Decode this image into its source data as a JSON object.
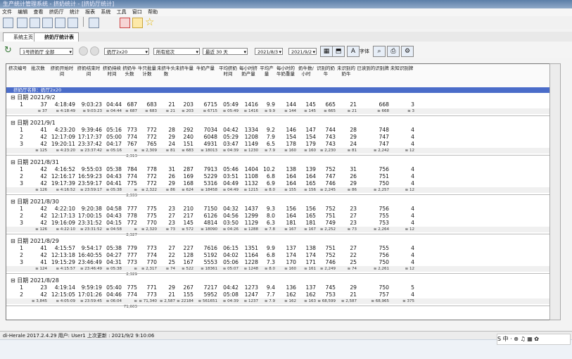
{
  "window": {
    "title": "生产统计管理系统 - 挤奶统计 - [挤奶厅统计]"
  },
  "menu": [
    "文件",
    "编辑",
    "查看",
    "挤奶厅",
    "统计",
    "报表",
    "系统",
    "工具",
    "窗口",
    "帮助"
  ],
  "tabs": [
    "系统主页",
    "挤奶厅统计表"
  ],
  "filters": {
    "farm": "1号挤奶厅 全部",
    "hall": "奶厅2x20",
    "hall2": "所有班次",
    "range": "最近 30 天",
    "date_from": "2021/8/3",
    "date_to": "2021/9/2",
    "font_label": "字体"
  },
  "columns": [
    "挤次编号",
    "批次数",
    "挤奶开始时间",
    "挤奶结束时间",
    "挤奶持续时间",
    "挤奶牛头数",
    "牛只批量计数",
    "未挤牛头数",
    "未挤牛量",
    "牛奶产量",
    "平均挤奶时间",
    "每小时挤奶产量",
    "平均产量",
    "每小时的牛奶重量",
    "奶牛数/小时",
    "识别的奶牛",
    "未识别的奶牛",
    "已读到的识别牌",
    "未知识别牌"
  ],
  "group_label": "挤奶厅名称：奶厅2x20",
  "days": [
    {
      "date": "日期 2021/9/2",
      "rows": [
        [
          "1",
          "37",
          "4:18:49",
          "9:03:23",
          "04:44",
          "687",
          "683",
          "21",
          "203",
          "6715",
          "05:49",
          "1416",
          "9.9",
          "144",
          "145",
          "665",
          "21",
          "668",
          "3"
        ]
      ],
      "sum": [
        "≅ 37",
        "≅ 4:18:49",
        "≅ 9:03:23",
        "≅ 04:44",
        "≅ 687",
        "≅ 683",
        "≅ 21",
        "≅ 203",
        "≅ 6715",
        "≅ 05:49",
        "≅ 1416",
        "≅ 9.9",
        "≅ 144",
        "≅ 145",
        "≅ 665",
        "≅ 21",
        "≅ 668",
        "≅ 3"
      ]
    },
    {
      "date": "日期 2021/9/1",
      "rows": [
        [
          "1",
          "41",
          "4:23:20",
          "9:39:46",
          "05:16",
          "773",
          "772",
          "28",
          "292",
          "7034",
          "04:42",
          "1334",
          "9.2",
          "146",
          "147",
          "744",
          "28",
          "748",
          "4"
        ],
        [
          "2",
          "42",
          "12:17:09",
          "17:17:37",
          "05:00",
          "774",
          "772",
          "29",
          "240",
          "6048",
          "05:29",
          "1208",
          "7.9",
          "154",
          "154",
          "743",
          "29",
          "747",
          "4"
        ],
        [
          "3",
          "42",
          "19:20:11",
          "23:37:42",
          "04:17",
          "767",
          "765",
          "24",
          "151",
          "4931",
          "03:47",
          "1149",
          "6.5",
          "178",
          "179",
          "743",
          "24",
          "747",
          "4"
        ]
      ],
      "sum": [
        "≅ 125",
        "≅ 4:23:20",
        "≅ 23:37:42",
        "≅ 05:16",
        "≅ 2,313",
        "≅ 2,309",
        "≅ 81",
        "≅ 683",
        "≅ 18013",
        "≅ 04:39",
        "≅ 1230",
        "≅ 7.9",
        "≅ 160",
        "≅ 160",
        "≅ 2,230",
        "≅ 81",
        "≅ 2,242",
        "≅ 12"
      ]
    },
    {
      "date": "日期 2021/8/31",
      "rows": [
        [
          "1",
          "42",
          "4:16:52",
          "9:55:03",
          "05:38",
          "784",
          "778",
          "31",
          "287",
          "7913",
          "05:46",
          "1404",
          "10.2",
          "138",
          "139",
          "752",
          "31",
          "756",
          "4"
        ],
        [
          "2",
          "42",
          "12:16:17",
          "16:59:23",
          "04:43",
          "774",
          "772",
          "26",
          "169",
          "5229",
          "03:51",
          "1108",
          "6.8",
          "164",
          "164",
          "747",
          "26",
          "751",
          "4"
        ],
        [
          "3",
          "42",
          "19:17:39",
          "23:59:17",
          "04:41",
          "775",
          "772",
          "29",
          "168",
          "5316",
          "04:49",
          "1132",
          "6.9",
          "164",
          "165",
          "746",
          "29",
          "750",
          "4"
        ]
      ],
      "sum": [
        "≅ 126",
        "≅ 4:16:52",
        "≅ 23:59:17",
        "≅ 05:38",
        "≅ 2,333",
        "≅ 2,322",
        "≅ 86",
        "≅ 624",
        "≅ 18458",
        "≅ 04:49",
        "≅ 1215",
        "≅ 8.0",
        "≅ 155",
        "≅ 156",
        "≅ 2,245",
        "≅ 86",
        "≅ 2,257",
        "≅ 12"
      ]
    },
    {
      "date": "日期 2021/8/30",
      "rows": [
        [
          "1",
          "42",
          "4:22:10",
          "9:20:38",
          "04:58",
          "777",
          "775",
          "23",
          "210",
          "7150",
          "04:32",
          "1437",
          "9.3",
          "156",
          "156",
          "752",
          "23",
          "756",
          "4"
        ],
        [
          "2",
          "42",
          "12:17:13",
          "17:00:15",
          "04:43",
          "778",
          "775",
          "27",
          "217",
          "6126",
          "04:56",
          "1299",
          "8.0",
          "164",
          "165",
          "751",
          "27",
          "755",
          "4"
        ],
        [
          "3",
          "42",
          "19:16:09",
          "23:31:52",
          "04:15",
          "772",
          "770",
          "23",
          "145",
          "4814",
          "03:50",
          "1129",
          "6.3",
          "181",
          "181",
          "749",
          "23",
          "753",
          "4"
        ]
      ],
      "sum": [
        "≅ 126",
        "≅ 4:22:10",
        "≅ 23:31:52",
        "≅ 04:58",
        "≅ 2,327",
        "≅ 2,320",
        "≅ 73",
        "≅ 572",
        "≅ 18090",
        "≅ 04:26",
        "≅ 1288",
        "≅ 7.8",
        "≅ 167",
        "≅ 167",
        "≅ 2,252",
        "≅ 73",
        "≅ 2,264",
        "≅ 12"
      ]
    },
    {
      "date": "日期 2021/8/29",
      "rows": [
        [
          "1",
          "41",
          "4:15:57",
          "9:54:17",
          "05:38",
          "779",
          "773",
          "27",
          "227",
          "7616",
          "06:15",
          "1351",
          "9.9",
          "137",
          "138",
          "751",
          "27",
          "755",
          "4"
        ],
        [
          "2",
          "42",
          "12:13:18",
          "16:40:55",
          "04:27",
          "777",
          "774",
          "22",
          "128",
          "5192",
          "04:02",
          "1164",
          "6.8",
          "174",
          "174",
          "752",
          "22",
          "756",
          "4"
        ],
        [
          "3",
          "41",
          "19:15:29",
          "23:46:49",
          "04:31",
          "773",
          "770",
          "25",
          "167",
          "5553",
          "05:06",
          "1228",
          "7.3",
          "170",
          "171",
          "746",
          "25",
          "750",
          "4"
        ]
      ],
      "sum": [
        "≅ 124",
        "≅ 4:15:57",
        "≅ 23:46:49",
        "≅ 05:38",
        "≅ 2,329",
        "≅ 2,317",
        "≅ 74",
        "≅ 522",
        "≅ 18361",
        "≅ 05:07",
        "≅ 1248",
        "≅ 8.0",
        "≅ 160",
        "≅ 161",
        "≅ 2,249",
        "≅ 74",
        "≅ 2,261",
        "≅ 12"
      ]
    },
    {
      "date": "日期 2021/8/28",
      "rows": [
        [
          "1",
          "23",
          "4:19:14",
          "9:59:19",
          "05:40",
          "775",
          "771",
          "29",
          "267",
          "7217",
          "04:42",
          "1273",
          "9.4",
          "136",
          "137",
          "745",
          "29",
          "750",
          "5"
        ],
        [
          "2",
          "42",
          "12:15:05",
          "17:01:26",
          "04:46",
          "774",
          "773",
          "21",
          "155",
          "5952",
          "05:08",
          "1247",
          "7.7",
          "162",
          "162",
          "753",
          "21",
          "757",
          "4"
        ]
      ],
      "sum": [
        "≅ 3,845",
        "≅ 4:05:09",
        "≅ 23:59:45",
        "≅ 06:04",
        "≅ 71,603",
        "≅ 71,340",
        "≅ 2,587",
        "≅ 22184",
        "≅ 561651",
        "≅ 04:39",
        "≅ 1237",
        "≅ 7.9",
        "≅ 162",
        "≅ 163",
        "≅ 68,599",
        "≅ 2,587",
        "≅ 68,965",
        "≅ 375"
      ]
    }
  ],
  "status": {
    "text": "di-Herale  2017.2.4.29  用户: User1  上次更新 : 2021/9/2 9:10:06"
  },
  "ime": {
    "text": "S 中 · ⊕ ♫ ▦ ✿"
  }
}
